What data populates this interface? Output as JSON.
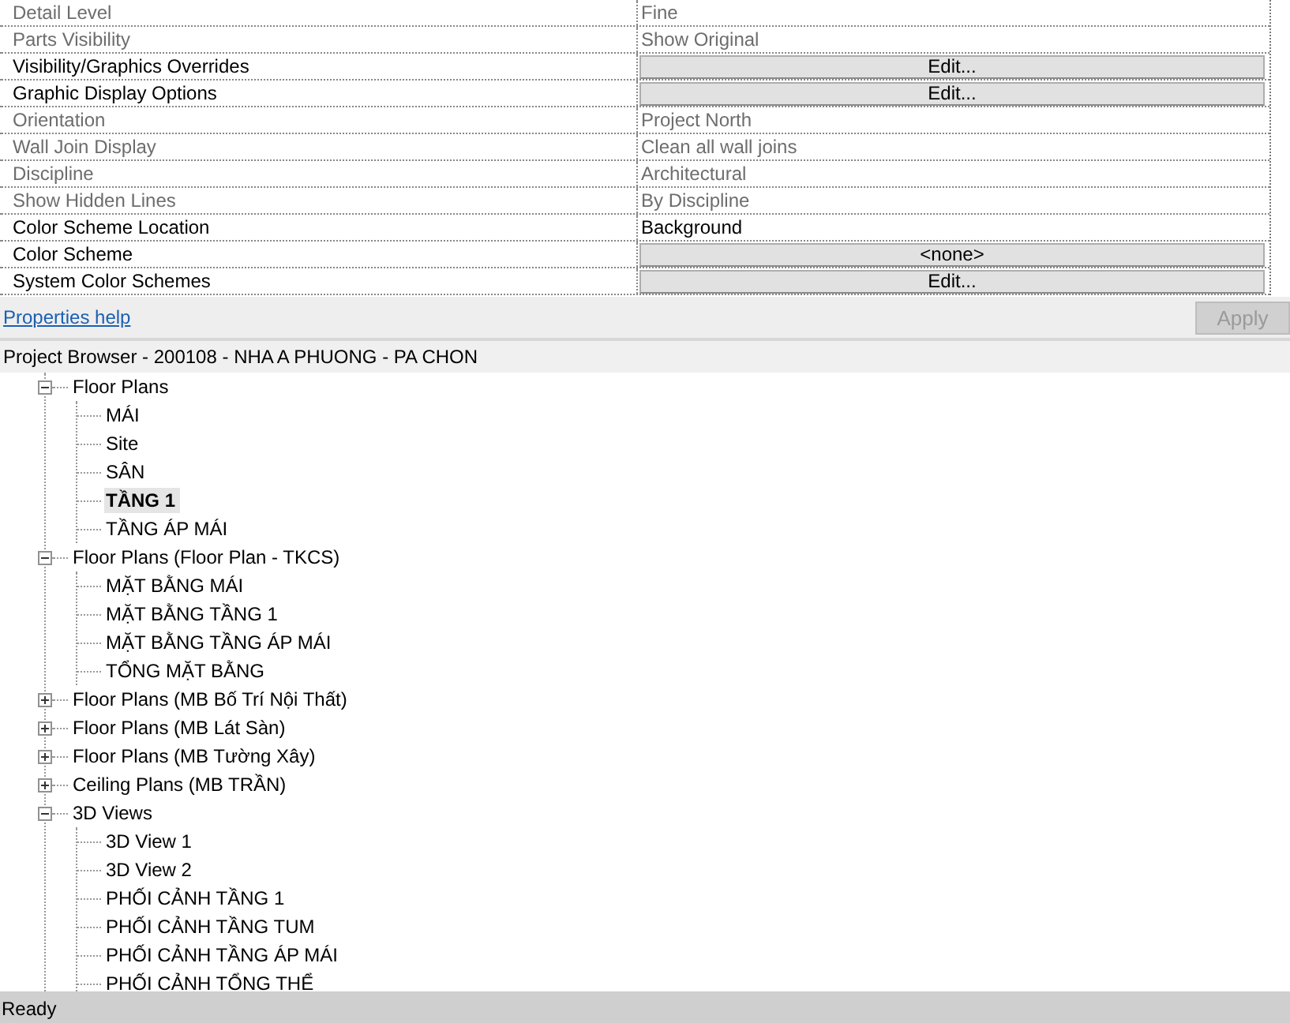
{
  "properties": [
    {
      "label": "Detail Level",
      "kind": "text",
      "value": "Fine",
      "disabled": true
    },
    {
      "label": "Parts Visibility",
      "kind": "text",
      "value": "Show Original",
      "disabled": true
    },
    {
      "label": "Visibility/Graphics Overrides",
      "kind": "button",
      "value": "Edit...",
      "disabled": false
    },
    {
      "label": "Graphic Display Options",
      "kind": "button",
      "value": "Edit...",
      "disabled": false
    },
    {
      "label": "Orientation",
      "kind": "text",
      "value": "Project North",
      "disabled": true
    },
    {
      "label": "Wall Join Display",
      "kind": "text",
      "value": "Clean all wall joins",
      "disabled": true
    },
    {
      "label": "Discipline",
      "kind": "text",
      "value": "Architectural",
      "disabled": true
    },
    {
      "label": "Show Hidden Lines",
      "kind": "text",
      "value": "By Discipline",
      "disabled": true
    },
    {
      "label": "Color Scheme Location",
      "kind": "text",
      "value": "Background",
      "disabled": false
    },
    {
      "label": "Color Scheme",
      "kind": "button",
      "value": "<none>",
      "disabled": false
    },
    {
      "label": "System Color Schemes",
      "kind": "button",
      "value": "Edit...",
      "disabled": false
    }
  ],
  "help_link": "Properties help",
  "apply_button": {
    "label": "Apply",
    "disabled": true
  },
  "browser_title": "Project Browser - 200108 - NHA A PHUONG - PA CHON",
  "tree": [
    {
      "label": "Floor Plans",
      "expanded": true,
      "children": [
        {
          "label": "MÁI",
          "selected": false
        },
        {
          "label": "Site",
          "selected": false
        },
        {
          "label": "SÂN",
          "selected": false
        },
        {
          "label": "TẦNG 1",
          "selected": true
        },
        {
          "label": "TẦNG ÁP MÁI",
          "selected": false
        }
      ]
    },
    {
      "label": "Floor Plans (Floor Plan - TKCS)",
      "expanded": true,
      "children": [
        {
          "label": "MẶT BẰNG MÁI",
          "selected": false
        },
        {
          "label": "MẶT BẰNG TẦNG 1",
          "selected": false
        },
        {
          "label": "MẶT BẰNG TẦNG ÁP MÁI",
          "selected": false
        },
        {
          "label": "TỔNG MẶT BẰNG",
          "selected": false
        }
      ]
    },
    {
      "label": "Floor Plans (MB Bố Trí Nội Thất)",
      "expanded": false
    },
    {
      "label": "Floor Plans (MB Lát Sàn)",
      "expanded": false
    },
    {
      "label": "Floor Plans (MB Tường Xây)",
      "expanded": false
    },
    {
      "label": "Ceiling Plans (MB TRẦN)",
      "expanded": false
    },
    {
      "label": "3D Views",
      "expanded": true,
      "children": [
        {
          "label": "3D View 1",
          "selected": false
        },
        {
          "label": "3D View 2",
          "selected": false
        },
        {
          "label": "PHỐI CẢNH TẦNG 1",
          "selected": false
        },
        {
          "label": "PHỐI CẢNH TẦNG TUM",
          "selected": false
        },
        {
          "label": "PHỐI CẢNH TẦNG ÁP MÁI",
          "selected": false
        },
        {
          "label": "PHỐI CẢNH TỔNG THỂ",
          "selected": false
        }
      ]
    }
  ],
  "status_bar": "Ready"
}
